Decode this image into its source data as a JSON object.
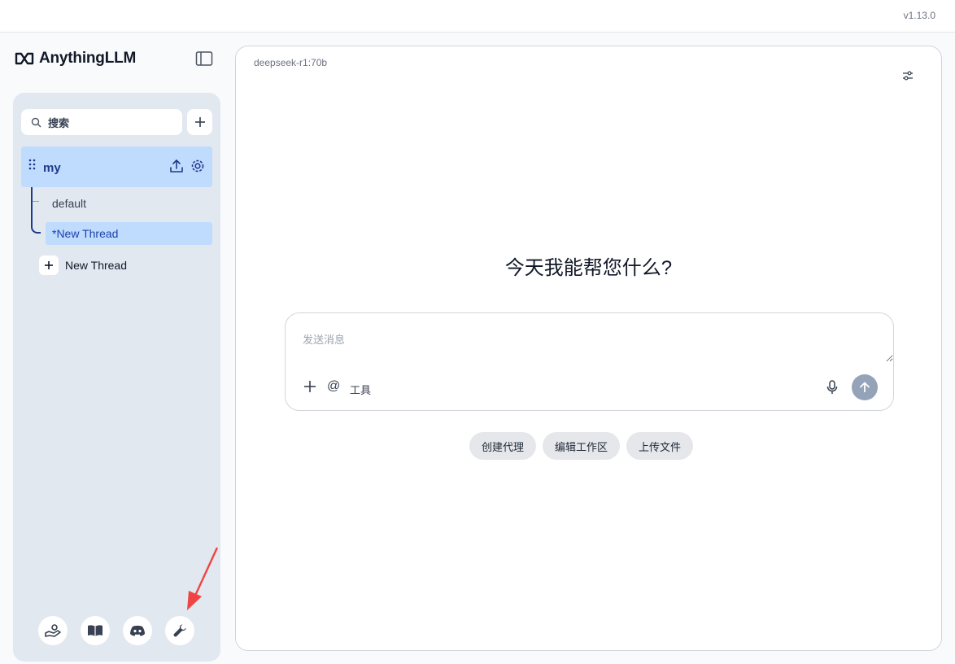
{
  "app": {
    "name": "AnythingLLM",
    "version": "v1.13.0"
  },
  "sidebar": {
    "search_placeholder": "搜索",
    "workspace": {
      "name": "my",
      "threads": [
        {
          "label": "default",
          "active": false
        },
        {
          "label": "*New Thread",
          "active": true
        }
      ]
    },
    "new_thread_label": "New Thread",
    "footer_icons": [
      "community-hub-icon",
      "docs-book-icon",
      "discord-icon",
      "wrench-icon"
    ]
  },
  "main": {
    "model": "deepseek-r1:70b",
    "greeting": "今天我能帮您什么?",
    "composer": {
      "placeholder": "发送消息",
      "at_symbol": "@",
      "tools_label": "工具"
    },
    "quick_actions": [
      "创建代理",
      "编辑工作区",
      "上传文件"
    ]
  },
  "colors": {
    "sidebar_bg": "#e2e8f0",
    "active_highlight": "#bfdbfe",
    "accent_navy": "#1e3a8a",
    "send_button": "#94a3b8",
    "annotation_arrow": "#ef4444"
  }
}
